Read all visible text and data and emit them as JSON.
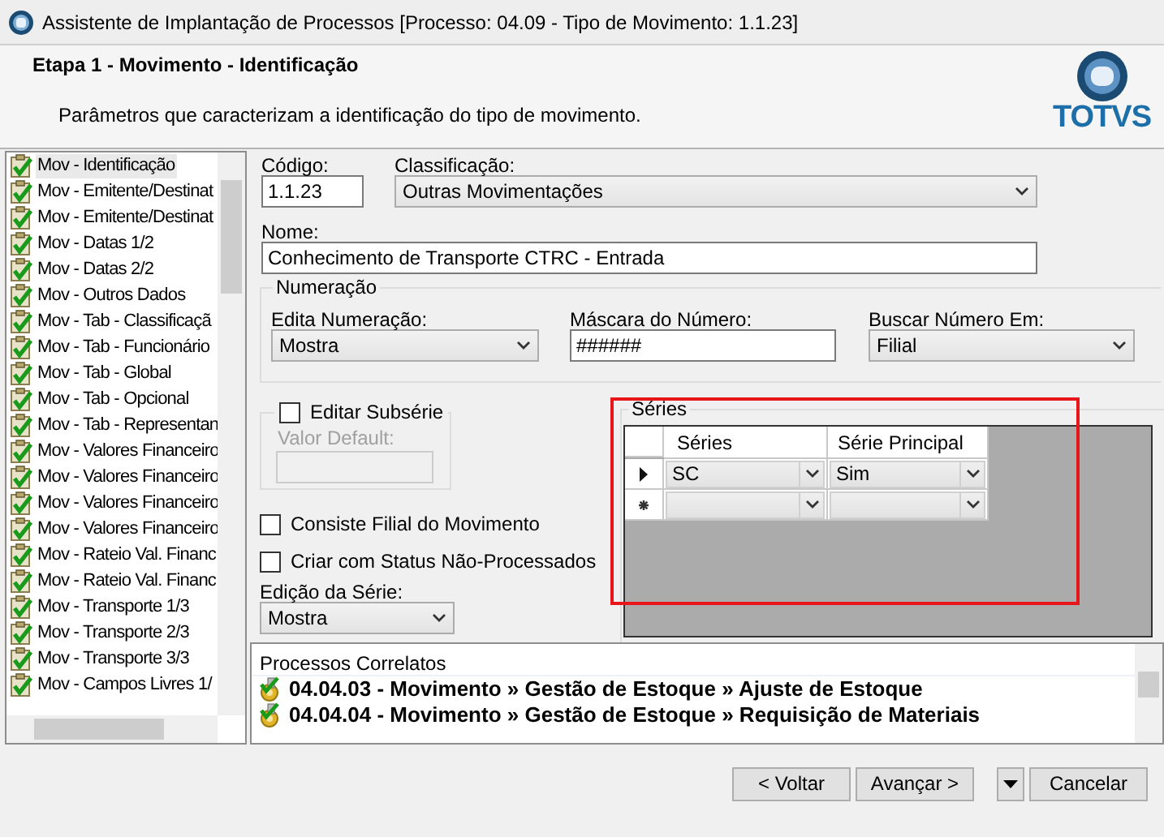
{
  "window": {
    "title": "Assistente de Implantação de Processos [Processo: 04.09 - Tipo de Movimento: 1.1.23]"
  },
  "header": {
    "title": "Etapa 1 - Movimento - Identificação",
    "subtitle": "Parâmetros que caracterizam a identificação do tipo de movimento.",
    "logo_text": "TOTVS"
  },
  "steps": [
    {
      "label": "Mov - Identificação",
      "checked": true,
      "selected": true
    },
    {
      "label": "Mov - Emitente/Destinat",
      "checked": true,
      "selected": false
    },
    {
      "label": "Mov - Emitente/Destinat",
      "checked": true,
      "selected": false
    },
    {
      "label": "Mov - Datas 1/2",
      "checked": true,
      "selected": false
    },
    {
      "label": "Mov - Datas 2/2",
      "checked": true,
      "selected": false
    },
    {
      "label": "Mov - Outros Dados",
      "checked": true,
      "selected": false
    },
    {
      "label": "Mov - Tab - Classificaçã",
      "checked": true,
      "selected": false
    },
    {
      "label": "Mov - Tab - Funcionário",
      "checked": true,
      "selected": false
    },
    {
      "label": "Mov - Tab - Global",
      "checked": true,
      "selected": false
    },
    {
      "label": "Mov - Tab - Opcional",
      "checked": true,
      "selected": false
    },
    {
      "label": "Mov - Tab - Representan",
      "checked": true,
      "selected": false
    },
    {
      "label": "Mov - Valores Financeiro",
      "checked": true,
      "selected": false
    },
    {
      "label": "Mov - Valores Financeiro",
      "checked": true,
      "selected": false
    },
    {
      "label": "Mov - Valores Financeiro",
      "checked": true,
      "selected": false
    },
    {
      "label": "Mov - Valores Financeiro",
      "checked": true,
      "selected": false
    },
    {
      "label": "Mov - Rateio Val. Financ",
      "checked": true,
      "selected": false
    },
    {
      "label": "Mov - Rateio Val. Financ",
      "checked": true,
      "selected": false
    },
    {
      "label": "Mov - Transporte 1/3",
      "checked": true,
      "selected": false
    },
    {
      "label": "Mov - Transporte 2/3",
      "checked": true,
      "selected": false
    },
    {
      "label": "Mov - Transporte 3/3",
      "checked": true,
      "selected": false
    },
    {
      "label": "Mov - Campos Livres 1/",
      "checked": true,
      "selected": false
    }
  ],
  "form": {
    "codigo": {
      "label": "Código:",
      "value": "1.1.23"
    },
    "classificacao": {
      "label": "Classificação:",
      "value": "Outras Movimentações"
    },
    "nome": {
      "label": "Nome:",
      "value": "Conhecimento de Transporte CTRC - Entrada"
    },
    "numeracao": {
      "title": "Numeração",
      "edita": {
        "label": "Edita Numeração:",
        "value": "Mostra"
      },
      "mascara": {
        "label": "Máscara do Número:",
        "value": "######"
      },
      "buscar": {
        "label": "Buscar Número Em:",
        "value": "Filial"
      }
    },
    "subserie": {
      "label": "Editar Subsérie",
      "checked": false,
      "default_label": "Valor Default:",
      "disabled": true
    },
    "consiste": {
      "label": "Consiste Filial do Movimento",
      "checked": false
    },
    "criar": {
      "label": "Criar com Status Não-Processados",
      "checked": false
    },
    "edicao": {
      "label": "Edição da Série:",
      "value": "Mostra"
    }
  },
  "series": {
    "title": "Séries",
    "highlighted": true,
    "columns": [
      "Séries",
      "Série Principal"
    ],
    "rows": [
      {
        "current": true,
        "new_row": false,
        "cells": [
          "SC",
          "Sim"
        ]
      },
      {
        "current": false,
        "new_row": true,
        "cells": []
      }
    ]
  },
  "related": {
    "title": "Processos Correlatos",
    "items": [
      {
        "text": "04.04.03 - Movimento » Gestão de Estoque » Ajuste de Estoque"
      },
      {
        "text": "04.04.04 - Movimento » Gestão de Estoque » Requisição de Materiais"
      }
    ]
  },
  "buttons": [
    {
      "kind": "text",
      "label": "< Voltar"
    },
    {
      "kind": "text",
      "label": "Avançar >"
    },
    {
      "kind": "menu"
    },
    {
      "kind": "text",
      "label": "Cancelar"
    }
  ]
}
